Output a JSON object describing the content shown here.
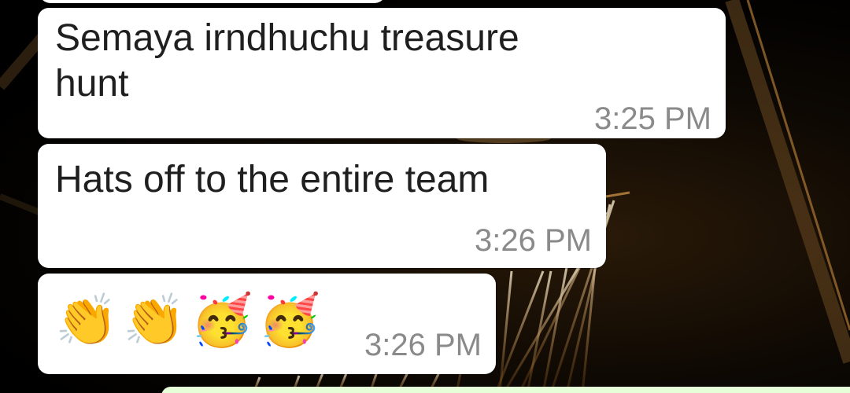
{
  "messages": [
    {
      "text": "",
      "time": ""
    },
    {
      "text_line1": "Semaya irndhuchu treasure",
      "text_line2": "hunt",
      "time": "3:25 PM"
    },
    {
      "text": "Hats off to the entire team",
      "time": "3:26 PM"
    },
    {
      "emojis": [
        "👏",
        "👏",
        "🥳",
        "🥳"
      ],
      "emoji_names": [
        "clapping-hands-emoji",
        "clapping-hands-emoji",
        "partying-face-emoji",
        "partying-face-emoji"
      ],
      "time": "3:26 PM"
    }
  ],
  "colors": {
    "incoming_bubble": "#ffffff",
    "outgoing_bubble": "#e7ffd9",
    "timestamp": "#8a8a8a",
    "text": "#1f1f1f"
  }
}
